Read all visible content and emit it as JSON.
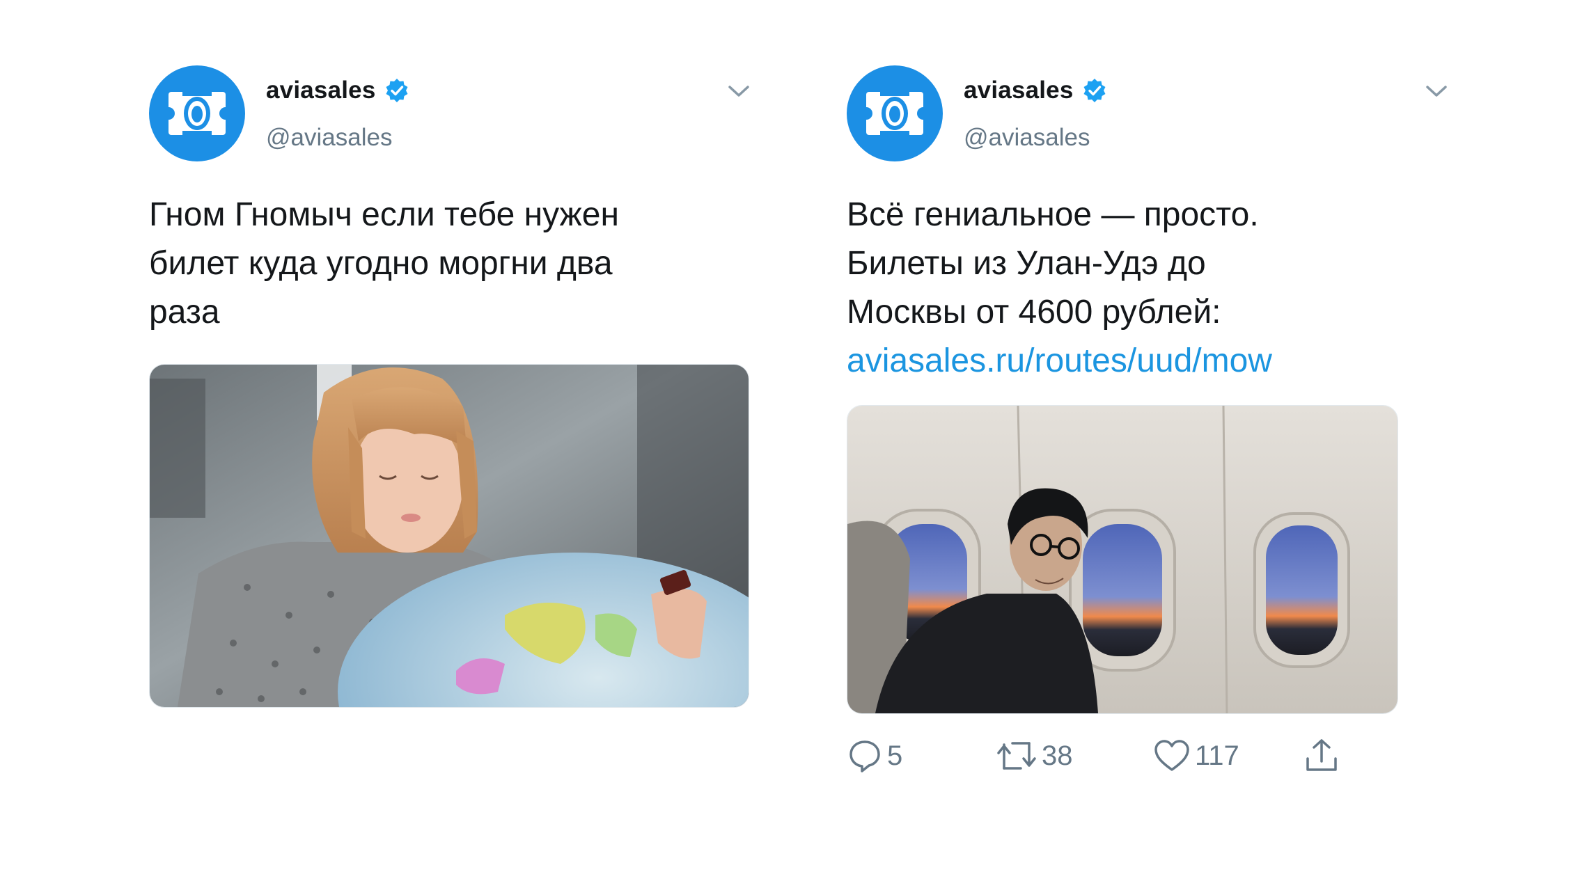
{
  "colors": {
    "brand_blue": "#1c8fe5",
    "verified_blue": "#1da1f2",
    "link_blue": "#1b95e0",
    "text_primary": "#14171a",
    "text_secondary": "#657786"
  },
  "tweets": [
    {
      "author": {
        "display_name": "aviasales",
        "handle": "@aviasales",
        "avatar_icon": "aviasales-logo-icon",
        "verified_icon": "verified-badge-icon"
      },
      "menu_icon": "chevron-down-icon",
      "text": "Гном Гномыч если тебе нужен\nбилет куда угодно моргни два\nраза",
      "media": {
        "type": "image"
      }
    },
    {
      "author": {
        "display_name": "aviasales",
        "handle": "@aviasales",
        "avatar_icon": "aviasales-logo-icon",
        "verified_icon": "verified-badge-icon"
      },
      "menu_icon": "chevron-down-icon",
      "text": "Всё гениальное — просто.\nБилеты из Улан-Удэ до\nМосквы от 4600 рублей:",
      "link": "aviasales.ru/routes/uud/mow",
      "media": {
        "type": "image"
      },
      "actions": {
        "reply": {
          "icon": "reply-icon",
          "count": "5"
        },
        "retweet": {
          "icon": "retweet-icon",
          "count": "38"
        },
        "like": {
          "icon": "heart-icon",
          "count": "117"
        },
        "share": {
          "icon": "share-icon"
        }
      }
    }
  ]
}
